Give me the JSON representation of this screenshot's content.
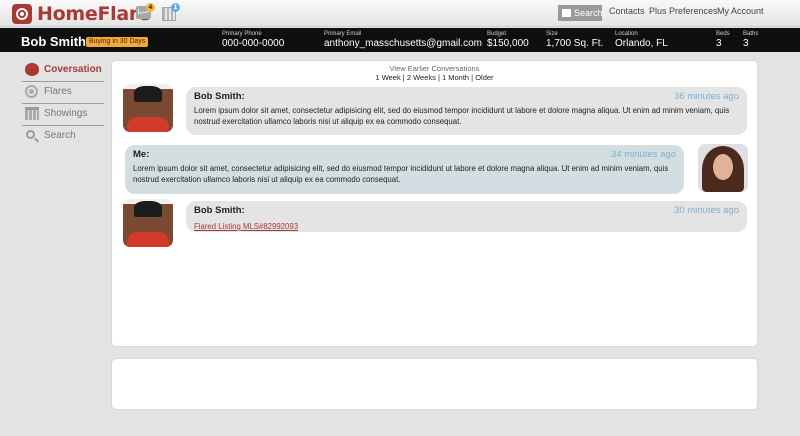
{
  "brand": {
    "name": "HomeFlare"
  },
  "topbar": {
    "mail_count": "4",
    "calendar_count": "1",
    "search_label": "Search",
    "links": [
      "Contacts",
      "Plus Preferences",
      "My Account"
    ]
  },
  "contact": {
    "name": "Bob Smith",
    "status_badge": "Buying in 30 Days",
    "primary_phone_label": "Primary Phone",
    "primary_phone": "000-000-0000",
    "primary_email_label": "Primary Email",
    "primary_email": "anthony_masschusetts@gmail.com",
    "budget_label": "Budget",
    "budget": "$150,000",
    "size_label": "Size",
    "size": "1,700 Sq. Ft.",
    "location_label": "Location",
    "location": "Orlando, FL",
    "beds_label": "Beds",
    "beds": "3",
    "baths_label": "Baths",
    "baths": "3"
  },
  "sidebar": {
    "items": [
      {
        "label": "Coversation",
        "icon": "conversation-icon",
        "active": true
      },
      {
        "label": "Flares",
        "icon": "flare-icon",
        "active": false
      },
      {
        "label": "Showings",
        "icon": "calendar-icon",
        "active": false
      },
      {
        "label": "Search",
        "icon": "search-icon",
        "active": false
      }
    ]
  },
  "conversation": {
    "view_earlier": "View Earlier Conversations",
    "ranges": "1 Week | 2 Weeks | 1 Month | Older",
    "messages": [
      {
        "sender": "Bob Smith:",
        "time": "36 minutes ago",
        "text": "Lorem ipsum dolor sit amet, consectetur adipisicing elit, sed do eiusmod tempor incididunt ut labore et dolore magna aliqua. Ut enim ad minim veniam, quis nostrud exercitation ullamco laboris nisi ut aliquip ex ea commodo consequat."
      },
      {
        "sender": "Me:",
        "time": "34 minutes ago",
        "text": "Lorem ipsum dolor sit amet, consectetur adipisicing elit, sed do eiusmod tempor incididunt ut labore et dolore magna aliqua. Ut enim ad minim veniam, quis nostrud exercitation ullamco laboris nisi ut aliquip ex ea commodo consequat."
      },
      {
        "sender": "Bob Smith:",
        "time": "30 minutes ago",
        "link": "Flared Listing MLS#82992093"
      }
    ]
  },
  "colors": {
    "brand": "#a83a35",
    "contact_bar": "#0f0f0f",
    "badge": "#f0a93c",
    "timestamp": "#7fb0d2",
    "bubble_them": "#e4e4e4",
    "bubble_me": "#d3dee3"
  }
}
